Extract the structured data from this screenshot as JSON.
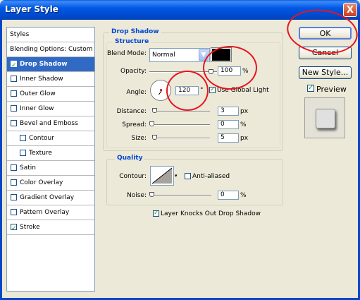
{
  "window": {
    "title": "Layer Style",
    "close_glyph": "X"
  },
  "styles_list": {
    "items": [
      {
        "label": "Styles",
        "checkbox": false,
        "checked": false,
        "selected": false,
        "indent": false
      },
      {
        "label": "Blending Options: Custom",
        "checkbox": false,
        "checked": false,
        "selected": false,
        "indent": false
      },
      {
        "label": "Drop Shadow",
        "checkbox": true,
        "checked": true,
        "selected": true,
        "indent": false
      },
      {
        "label": "Inner Shadow",
        "checkbox": true,
        "checked": false,
        "selected": false,
        "indent": false
      },
      {
        "label": "Outer Glow",
        "checkbox": true,
        "checked": false,
        "selected": false,
        "indent": false
      },
      {
        "label": "Inner Glow",
        "checkbox": true,
        "checked": false,
        "selected": false,
        "indent": false
      },
      {
        "label": "Bevel and Emboss",
        "checkbox": true,
        "checked": false,
        "selected": false,
        "indent": false
      },
      {
        "label": "Contour",
        "checkbox": true,
        "checked": false,
        "selected": false,
        "indent": true
      },
      {
        "label": "Texture",
        "checkbox": true,
        "checked": false,
        "selected": false,
        "indent": true
      },
      {
        "label": "Satin",
        "checkbox": true,
        "checked": false,
        "selected": false,
        "indent": false
      },
      {
        "label": "Color Overlay",
        "checkbox": true,
        "checked": false,
        "selected": false,
        "indent": false
      },
      {
        "label": "Gradient Overlay",
        "checkbox": true,
        "checked": false,
        "selected": false,
        "indent": false
      },
      {
        "label": "Pattern Overlay",
        "checkbox": true,
        "checked": false,
        "selected": false,
        "indent": false
      },
      {
        "label": "Stroke",
        "checkbox": true,
        "checked": true,
        "selected": false,
        "indent": false
      }
    ]
  },
  "drop_shadow": {
    "group_title": "Drop Shadow",
    "structure_title": "Structure",
    "blend_mode_label": "Blend Mode:",
    "blend_mode_value": "Normal",
    "shadow_color": "#000000",
    "opacity_label": "Opacity:",
    "opacity_value": "100",
    "opacity_unit": "%",
    "angle_label": "Angle:",
    "angle_value": "120",
    "angle_unit": "°",
    "use_global_light_label": "Use Global Light",
    "use_global_light_checked": true,
    "distance_label": "Distance:",
    "distance_value": "3",
    "distance_unit": "px",
    "spread_label": "Spread:",
    "spread_value": "0",
    "spread_unit": "%",
    "size_label": "Size:",
    "size_value": "5",
    "size_unit": "px"
  },
  "quality": {
    "group_title": "Quality",
    "contour_label": "Contour:",
    "anti_aliased_label": "Anti-aliased",
    "anti_aliased_checked": false,
    "noise_label": "Noise:",
    "noise_value": "0",
    "noise_unit": "%"
  },
  "knockout": {
    "label": "Layer Knocks Out Drop Shadow",
    "checked": true
  },
  "buttons": {
    "ok_label": "OK",
    "cancel_label": "Cancel",
    "new_style_label": "New Style...",
    "preview_label": "Preview",
    "preview_checked": true
  },
  "colors": {
    "title_bar": "#0058e6",
    "selection": "#316ac5",
    "annotation_circle": "#e8141c",
    "legend_text": "#0046d5"
  }
}
